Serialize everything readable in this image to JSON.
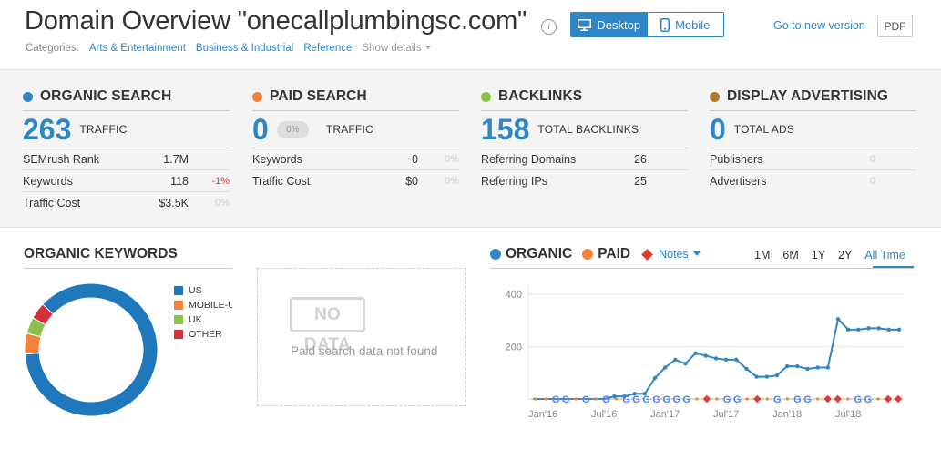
{
  "header": {
    "title": "Domain Overview \"onecallplumbingsc.com\"",
    "info_icon": "i",
    "view_toggle": {
      "desktop_label": "Desktop",
      "mobile_label": "Mobile",
      "active": "Desktop"
    },
    "new_version_link": "Go to new version",
    "pdf_label": "PDF",
    "categories_label": "Categories:",
    "categories": [
      "Arts & Entertainment",
      "Business & Industrial",
      "Reference"
    ],
    "show_details": "Show details"
  },
  "summary": {
    "organic": {
      "title": "ORGANIC SEARCH",
      "color": "#2e86c7",
      "value": "263",
      "value_label": "TRAFFIC",
      "rows": [
        {
          "label": "SEMrush Rank",
          "value": "1.7M",
          "change": ""
        },
        {
          "label": "Keywords",
          "value": "118",
          "change": "-1%"
        },
        {
          "label": "Traffic Cost",
          "value": "$3.5K",
          "change": "0%"
        }
      ]
    },
    "paid": {
      "title": "PAID SEARCH",
      "color": "#f4823b",
      "value": "0",
      "pill": "0%",
      "value_label": "TRAFFIC",
      "rows": [
        {
          "label": "Keywords",
          "value": "0",
          "change": "0%"
        },
        {
          "label": "Traffic Cost",
          "value": "$0",
          "change": "0%"
        }
      ]
    },
    "backlinks": {
      "title": "BACKLINKS",
      "color": "#8bc34a",
      "value": "158",
      "value_label": "TOTAL BACKLINKS",
      "rows": [
        {
          "label": "Referring Domains",
          "value": "26",
          "change": ""
        },
        {
          "label": "Referring IPs",
          "value": "25",
          "change": ""
        }
      ]
    },
    "display": {
      "title": "DISPLAY ADVERTISING",
      "color": "#b5792c",
      "value": "0",
      "value_label": "TOTAL ADS",
      "rows": [
        {
          "label": "Publishers",
          "value": "0",
          "change": ""
        },
        {
          "label": "Advertisers",
          "value": "0",
          "change": ""
        }
      ]
    }
  },
  "organic_keywords": {
    "title": "ORGANIC KEYWORDS",
    "legend": [
      {
        "label": "US",
        "color": "#1f77bc"
      },
      {
        "label": "MOBILE-US",
        "color": "#f4823b"
      },
      {
        "label": "UK",
        "color": "#8bc34a"
      },
      {
        "label": "OTHER",
        "color": "#d62f3c"
      }
    ]
  },
  "paid_keywords": {
    "badge": "NO DATA",
    "message": "Paid search data not found"
  },
  "trend": {
    "legend_organic": "ORGANIC",
    "legend_paid": "PAID",
    "notes": "Notes",
    "ranges": [
      "1M",
      "6M",
      "1Y",
      "2Y",
      "All Time"
    ],
    "active_range": "All Time",
    "colors": {
      "organic": "#2e86c7",
      "paid": "#f4823b",
      "note": "#e53935",
      "google": "#4285f4"
    }
  },
  "chart_data": [
    {
      "type": "pie",
      "categories": [
        "US",
        "MOBILE-US",
        "UK",
        "OTHER"
      ],
      "values": [
        87,
        5,
        4,
        4
      ]
    },
    {
      "type": "line",
      "x": [
        "Dec '15",
        "Jan '16",
        "Feb '16",
        "Mar '16",
        "Apr '16",
        "May '16",
        "Jun '16",
        "Jul '16",
        "Aug '16",
        "Sep '16",
        "Oct '16",
        "Nov '16",
        "Dec '16",
        "Jan '17",
        "Feb '17",
        "Mar '17",
        "Apr '17",
        "May '17",
        "Jun '17",
        "Jul '17",
        "Aug '17",
        "Sep '17",
        "Oct '17",
        "Nov '17",
        "Dec '17",
        "Jan '18",
        "Feb '18",
        "Mar '18",
        "Apr '18",
        "May '18",
        "Jun '18",
        "Jul '18"
      ],
      "series": [
        {
          "name": "ORGANIC",
          "values": [
            0,
            0,
            0,
            0,
            0,
            0,
            0,
            0,
            10,
            10,
            20,
            20,
            80,
            120,
            150,
            135,
            175,
            165,
            155,
            150,
            150,
            115,
            85,
            85,
            90,
            125,
            125,
            115,
            120,
            120,
            305,
            265,
            265,
            270,
            270,
            265,
            265
          ]
        },
        {
          "name": "PAID",
          "values": [
            0,
            0,
            0,
            0,
            0,
            0,
            0,
            0,
            0,
            0,
            0,
            0,
            0,
            0,
            0,
            0,
            0,
            0,
            0,
            0,
            0,
            0,
            0,
            0,
            0,
            0,
            0,
            0,
            0,
            0,
            0,
            0,
            0,
            0,
            0,
            0,
            0
          ]
        }
      ],
      "x_ticks": [
        "Jan'16",
        "Jul'16",
        "Jan'17",
        "Jul'17",
        "Jan'18",
        "Jul'18"
      ],
      "y_ticks": [
        "200",
        "400"
      ],
      "ylim": [
        0,
        400
      ],
      "markers": [
        "G",
        "G",
        "G",
        "G",
        "G",
        "G",
        "G",
        "G",
        "G",
        "G",
        "G",
        "G",
        "G",
        "G",
        "G",
        "G",
        "G",
        "G",
        "G",
        "G"
      ]
    }
  ]
}
